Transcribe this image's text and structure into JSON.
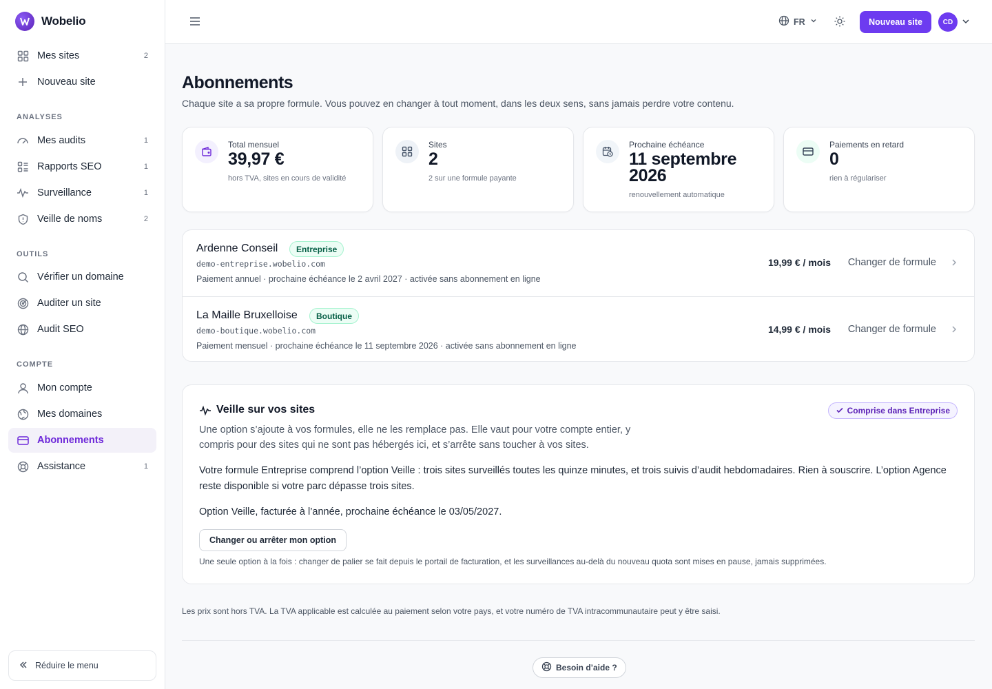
{
  "app": {
    "name": "Wobelio"
  },
  "sidebar": {
    "primary": [
      {
        "label": "Mes sites",
        "count": "2"
      },
      {
        "label": "Nouveau site",
        "count": ""
      }
    ],
    "sections": [
      {
        "title": "ANALYSES",
        "items": [
          {
            "label": "Mes audits",
            "count": "1"
          },
          {
            "label": "Rapports SEO",
            "count": "1"
          },
          {
            "label": "Surveillance",
            "count": "1"
          },
          {
            "label": "Veille de noms",
            "count": "2"
          }
        ]
      },
      {
        "title": "OUTILS",
        "items": [
          {
            "label": "Vérifier un domaine",
            "count": ""
          },
          {
            "label": "Auditer un site",
            "count": ""
          },
          {
            "label": "Audit SEO",
            "count": ""
          }
        ]
      },
      {
        "title": "COMPTE",
        "items": [
          {
            "label": "Mon compte",
            "count": ""
          },
          {
            "label": "Mes domaines",
            "count": ""
          },
          {
            "label": "Abonnements",
            "count": ""
          },
          {
            "label": "Assistance",
            "count": "1"
          }
        ]
      }
    ],
    "collapse_label": "Réduire le menu"
  },
  "topbar": {
    "language": "FR",
    "new_site_label": "Nouveau site",
    "avatar_initials": "CD"
  },
  "page": {
    "title": "Abonnements",
    "subtitle": "Chaque site a sa propre formule. Vous pouvez en changer à tout moment, dans les deux sens, sans jamais perdre votre contenu."
  },
  "stats": [
    {
      "label": "Total mensuel",
      "value": "39,97 €",
      "note": "hors TVA, sites en cours de validité",
      "icon": "wallet-icon"
    },
    {
      "label": "Sites",
      "value": "2",
      "note": "2 sur une formule payante",
      "icon": "grid-icon"
    },
    {
      "label": "Prochaine échéance",
      "value": "11 septembre 2026",
      "note": "renouvellement automatique",
      "icon": "calendar-clock-icon"
    },
    {
      "label": "Paiements en retard",
      "value": "0",
      "note": "rien à régulariser",
      "icon": "credit-card-icon"
    }
  ],
  "subscriptions": [
    {
      "name": "Ardenne Conseil",
      "plan": "Entreprise",
      "domain": "demo-entreprise.wobelio.com",
      "details": "Paiement annuel · prochaine échéance le 2 avril 2027 · activée sans abonnement en ligne",
      "price": "19,99 € / mois",
      "change_label": "Changer de formule"
    },
    {
      "name": "La Maille Bruxelloise",
      "plan": "Boutique",
      "domain": "demo-boutique.wobelio.com",
      "details": "Paiement mensuel · prochaine échéance le 11 septembre 2026 · activée sans abonnement en ligne",
      "price": "14,99 € / mois",
      "change_label": "Changer de formule"
    }
  ],
  "veille": {
    "title": "Veille sur vos sites",
    "badge": "Comprise dans Entreprise",
    "description": "Une option s’ajoute à vos formules, elle ne les remplace pas. Elle vaut pour votre compte entier, y compris pour des sites qui ne sont pas hébergés ici, et s’arrête sans toucher à vos sites.",
    "plan_text": "Votre formule Entreprise comprend l’option Veille : trois sites surveillés toutes les quinze minutes, et trois suivis d’audit hebdomadaires. Rien à souscrire. L’option Agence reste disponible si votre parc dépasse trois sites.",
    "billing_text": "Option Veille, facturée à l’année, prochaine échéance le 03/05/2027.",
    "button_label": "Changer ou arrêter mon option",
    "note": "Une seule option à la fois : changer de palier se fait depuis le portail de facturation, et les surveillances au-delà du nouveau quota sont mises en pause, jamais supprimées."
  },
  "footer": {
    "vat_note": "Les prix sont hors TVA. La TVA applicable est calculée au paiement selon votre pays, et votre numéro de TVA intracommunautaire peut y être saisi.",
    "help_label": "Besoin d’aide ?"
  },
  "colors": {
    "accent": "#6d3bf0",
    "active_bg": "#f3f1f9",
    "badge_green": "#ecfdf5"
  }
}
